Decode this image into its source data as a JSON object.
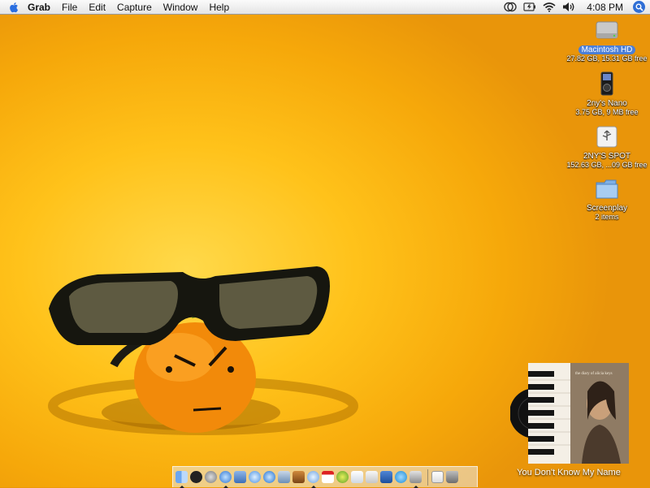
{
  "menubar": {
    "app_name": "Grab",
    "items": [
      "File",
      "Edit",
      "Capture",
      "Window",
      "Help"
    ],
    "clock": "4:08 PM",
    "status_icons": [
      "sync-icon",
      "battery-icon",
      "wifi-icon",
      "volume-icon"
    ]
  },
  "desktop_icons": [
    {
      "name": "Macintosh HD",
      "info": "27.82 GB, 15.31 GB free",
      "icon": "hard-drive-icon",
      "selected": true
    },
    {
      "name": "2ny's Nano",
      "info": "3.75 GB, 9 MB free",
      "icon": "ipod-nano-icon",
      "selected": false
    },
    {
      "name": "2NY'S SPOT",
      "info": "152.63 GB, ...09 GB free",
      "icon": "usb-drive-icon",
      "selected": false
    },
    {
      "name": "Screenplay",
      "info": "2 items",
      "icon": "folder-icon",
      "selected": false
    }
  ],
  "now_playing": {
    "track": "You Don't Know My Name",
    "album_text": "the diary of alicia keys"
  },
  "dock": {
    "apps": [
      "finder",
      "dashboard",
      "system-preferences",
      "safari",
      "iphoto",
      "ichat",
      "quicktime",
      "ical-audio",
      "garageband",
      "itunes",
      "ical",
      "adium",
      "preview",
      "textedit",
      "word",
      "skype",
      "grab"
    ],
    "running": [
      "finder",
      "safari",
      "itunes",
      "grab"
    ]
  },
  "colors": {
    "wallpaper": "#ffc21a",
    "selection": "#4b7fd8"
  }
}
